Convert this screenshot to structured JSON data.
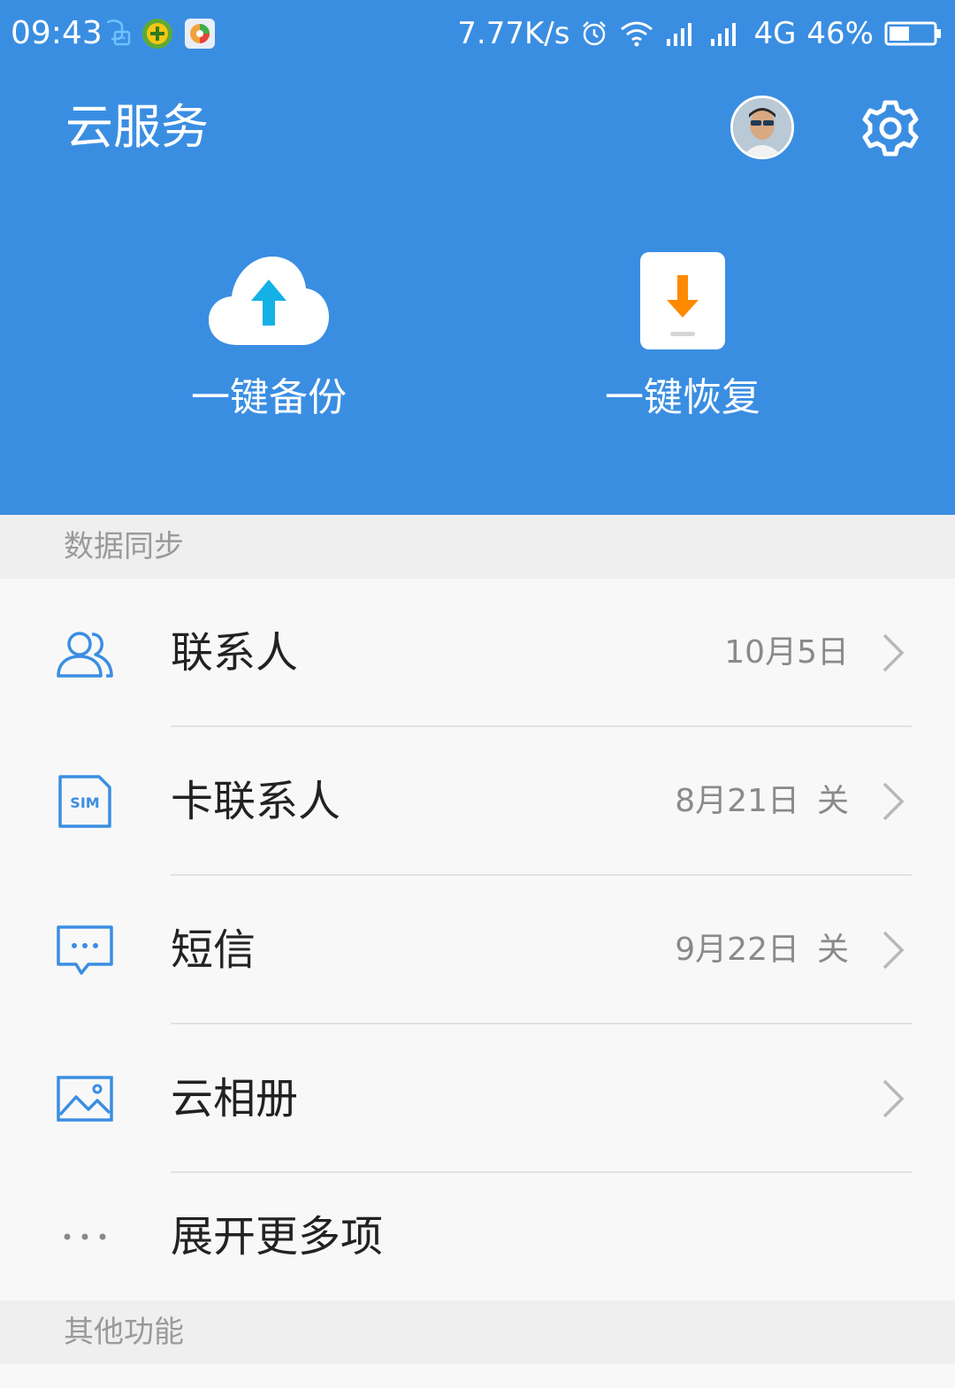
{
  "status_bar": {
    "time": "09:43",
    "speed": "7.77K/s",
    "network": "4G",
    "battery": "46%"
  },
  "header": {
    "title": "云服务",
    "backup_label": "一键备份",
    "restore_label": "一键恢复"
  },
  "sections": {
    "sync": "数据同步",
    "other": "其他功能"
  },
  "items": [
    {
      "title": "联系人",
      "date": "10月5日",
      "status": ""
    },
    {
      "title": "卡联系人",
      "date": "8月21日",
      "status": "关"
    },
    {
      "title": "短信",
      "date": "9月22日",
      "status": "关"
    },
    {
      "title": "云相册",
      "date": "",
      "status": ""
    },
    {
      "title": "展开更多项"
    }
  ],
  "icons": {
    "contacts": "contacts-icon",
    "sim": "sim-card-icon",
    "sms": "message-icon",
    "album": "image-icon",
    "more": "more-dots-icon",
    "settings": "gear-icon",
    "backup": "cloud-upload-icon",
    "restore": "download-icon"
  },
  "sim_label": "SIM",
  "colors": {
    "primary": "#3a8ee2",
    "icon_blue": "#3a8ee2",
    "upload_arrow": "#14b1e7",
    "download_arrow": "#ff8a00"
  }
}
